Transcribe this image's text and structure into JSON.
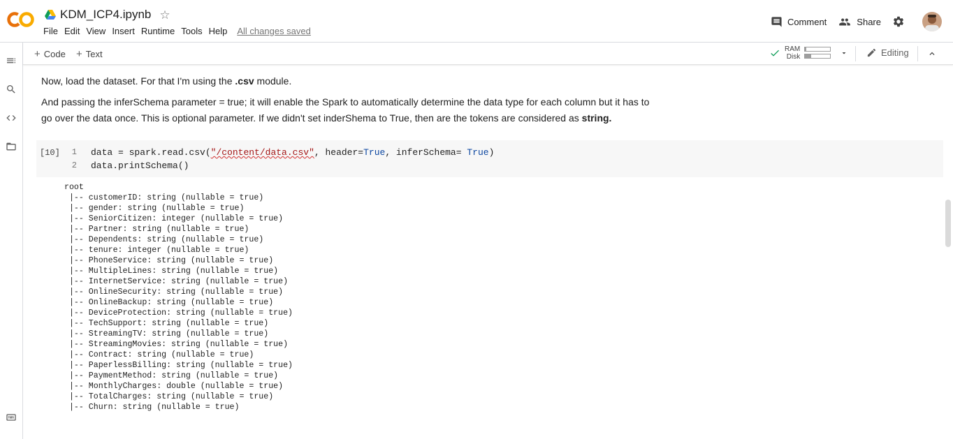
{
  "app": {
    "notebook_title": "KDM_ICP4.ipynb",
    "logo_text": "CO",
    "saved_status": "All changes saved"
  },
  "menu": [
    "File",
    "Edit",
    "View",
    "Insert",
    "Runtime",
    "Tools",
    "Help"
  ],
  "header_actions": {
    "comment_label": "Comment",
    "share_label": "Share"
  },
  "toolbar": {
    "code_label": "Code",
    "text_label": "Text",
    "ram_label": "RAM",
    "disk_label": "Disk",
    "ram_usage": 0.05,
    "disk_usage": 0.25,
    "editing_label": "Editing"
  },
  "text_cell": {
    "p1_before": "Now, load the dataset. For that I'm using the ",
    "p1_bold": ".csv",
    "p1_after": " module.",
    "p2_line1": "And passing the inferSchema parameter = true; it will enable the Spark to automatically determine the data type for each column but it has to",
    "p2_line2_before": "go over the data once. This is optional parameter. If we didn't set inderShema to True, then are the tokens are considered as ",
    "p2_bold": "string."
  },
  "code_cell": {
    "execution_count": "[10]",
    "line_numbers": [
      "1",
      "2"
    ],
    "line1_a": "data = spark.read.csv(",
    "line1_str": "\"/content/data.csv\"",
    "line1_b": ", header=",
    "line1_kw1": "True",
    "line1_c": ", inferSchema= ",
    "line1_kw2": "True",
    "line1_d": ")",
    "line2": "data.printSchema()"
  },
  "output_lines": [
    "root",
    " |-- customerID: string (nullable = true)",
    " |-- gender: string (nullable = true)",
    " |-- SeniorCitizen: integer (nullable = true)",
    " |-- Partner: string (nullable = true)",
    " |-- Dependents: string (nullable = true)",
    " |-- tenure: integer (nullable = true)",
    " |-- PhoneService: string (nullable = true)",
    " |-- MultipleLines: string (nullable = true)",
    " |-- InternetService: string (nullable = true)",
    " |-- OnlineSecurity: string (nullable = true)",
    " |-- OnlineBackup: string (nullable = true)",
    " |-- DeviceProtection: string (nullable = true)",
    " |-- TechSupport: string (nullable = true)",
    " |-- StreamingTV: string (nullable = true)",
    " |-- StreamingMovies: string (nullable = true)",
    " |-- Contract: string (nullable = true)",
    " |-- PaperlessBilling: string (nullable = true)",
    " |-- PaymentMethod: string (nullable = true)",
    " |-- MonthlyCharges: double (nullable = true)",
    " |-- TotalCharges: string (nullable = true)",
    " |-- Churn: string (nullable = true)"
  ],
  "colors": {
    "logo_orange": "#f9ab00",
    "logo_dark_orange": "#e8710a",
    "check_green": "#0f9d58",
    "keyword_blue": "#0d47a1",
    "string_red": "#a31515"
  }
}
